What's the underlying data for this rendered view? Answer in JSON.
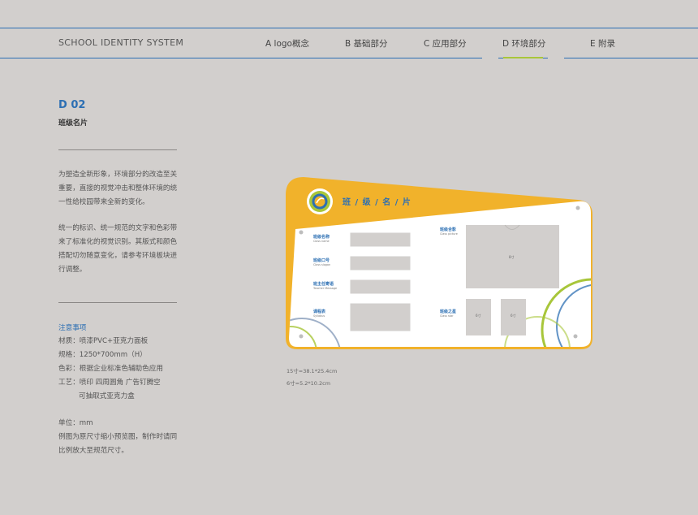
{
  "header": {
    "brand": "SCHOOL IDENTITY SYSTEM",
    "nav": [
      {
        "label": "A logo概念"
      },
      {
        "label": "B 基础部分"
      },
      {
        "label": "C 应用部分"
      },
      {
        "label": "D 环境部分",
        "active": true
      },
      {
        "label": "E 附录"
      }
    ],
    "accent_color": "#2c6fb3",
    "active_underline_color": "#a8c63a"
  },
  "section": {
    "code": "D 02",
    "title": "班级名片",
    "intro_lines": [
      "为塑造全新形象，环境部分的改造至关",
      "重要，直接的视觉冲击和整体环境的统",
      "一性给校园带来全新的变化。"
    ],
    "body_lines": [
      "统一的标识、统一规范的文字和色彩带",
      "来了标准化的视觉识别。其版式和颜色",
      "搭配切勿随意变化，请参考环境板块进",
      "行调整。"
    ]
  },
  "notes": {
    "title": "注意事项",
    "lines": [
      "材质：喷漆PVC+亚克力面板",
      "规格：1250*700mm（H）",
      "色彩：根据企业标准色辅助色应用",
      "工艺：喷印  四周圆角  广告钉腾空",
      "可抽取式亚克力盒"
    ],
    "unit_lines": [
      "单位：mm",
      "例图为原尺寸缩小预览图，制作时请同",
      "比例放大至规范尺寸。"
    ]
  },
  "board": {
    "title": "班 / 级 / 名 / 片",
    "left_fields": [
      {
        "label": "班级名称",
        "sub": "Class name"
      },
      {
        "label": "班级口号",
        "sub": "Class slogan"
      },
      {
        "label": "班主任寄语",
        "sub": "Teacher Message"
      },
      {
        "label": "课程表",
        "sub": "Syllabus"
      }
    ],
    "right_fields": [
      {
        "label": "班级合影",
        "sub": "Class picture",
        "slot": "8寸"
      },
      {
        "label": "班级之星",
        "sub": "Class star",
        "slots": [
          "6寸",
          "6寸"
        ]
      }
    ],
    "colors": {
      "yellow": "#f1b22b",
      "blue": "#2c6fb3",
      "green": "#a8c63a",
      "slot_gray": "#d2cfcd"
    }
  },
  "sizes": [
    "15寸=38.1*25.4cm",
    "6寸=5.2*10.2cm"
  ]
}
